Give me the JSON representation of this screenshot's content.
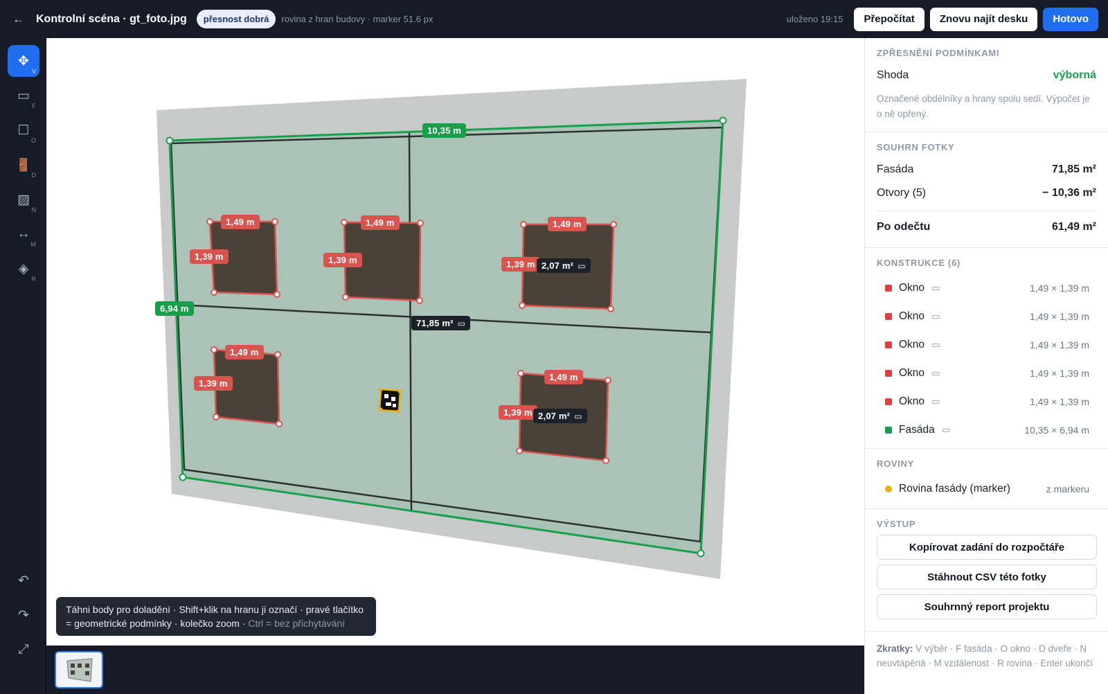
{
  "header": {
    "back_icon": "←",
    "title": "Kontrolní scéna · gt_foto.jpg",
    "badge": "přesnost dobrá",
    "subinfo": "rovina z hran budovy · marker 51.6 px",
    "saved": "uloženo 19:15",
    "btn_recalc": "Přepočítat",
    "btn_find": "Znovu najít desku",
    "btn_done": "Hotovo"
  },
  "tools": [
    {
      "icon": "✥",
      "key": "V",
      "name": "move-tool-icon"
    },
    {
      "icon": "▭",
      "key": "F",
      "name": "facade-tool-icon"
    },
    {
      "icon": "☐",
      "key": "O",
      "name": "window-tool-icon"
    },
    {
      "icon": "🚪",
      "key": "D",
      "name": "door-tool-icon"
    },
    {
      "icon": "▨",
      "key": "N",
      "name": "hatch-tool-icon"
    },
    {
      "icon": "↔",
      "key": "M",
      "name": "distance-tool-icon"
    },
    {
      "icon": "◈",
      "key": "R",
      "name": "plane-tool-icon"
    }
  ],
  "toolbar_bottom": {
    "undo": "↶",
    "redo": "↷",
    "fit": "⤢"
  },
  "canvas": {
    "labels": {
      "facade_width": "10,35 m",
      "facade_height": "6,94 m",
      "facade_area": "71,85 m²",
      "win_w": "1,49 m",
      "win_h": "1,39 m",
      "win_area": "2,07 m²",
      "edit_icon": "▭"
    },
    "hint": {
      "text": "Táhni body pro doladění · Shift+klik na hranu ji označí · pravé tlačítko = geometrické podmínky · kolečko zoom · ",
      "muted": "Ctrl = bez přichytávání"
    }
  },
  "panel": {
    "refine": {
      "heading": "ZPŘESNĚNÍ PODMÍNKAMI",
      "label": "Shoda",
      "value": "výborná",
      "note": "Označené obdélníky a hrany spolu sedí. Výpočet je o ně opřený."
    },
    "summary": {
      "heading": "SOUHRN FOTKY",
      "facade_label": "Fasáda",
      "facade_value": "71,85 m²",
      "openings_label": "Otvory (5)",
      "openings_value": "− 10,36 m²",
      "total_label": "Po odečtu",
      "total_value": "61,49 m²"
    },
    "constructions": {
      "heading": "KONSTRUKCE (6)",
      "icon": "▭",
      "items": [
        {
          "name": "Okno",
          "dims": "1,49 × 1,39 m",
          "color": "#e03f3f"
        },
        {
          "name": "Okno",
          "dims": "1,49 × 1,39 m",
          "color": "#e03f3f"
        },
        {
          "name": "Okno",
          "dims": "1,49 × 1,39 m",
          "color": "#e03f3f"
        },
        {
          "name": "Okno",
          "dims": "1,49 × 1,39 m",
          "color": "#e03f3f"
        },
        {
          "name": "Okno",
          "dims": "1,49 × 1,39 m",
          "color": "#e03f3f"
        },
        {
          "name": "Fasáda",
          "dims": "10,35 × 6,94 m",
          "color": "#17a04a"
        }
      ]
    },
    "planes": {
      "heading": "ROVINY",
      "item": "Rovina fasády (marker)",
      "source": "z markeru",
      "color": "#e9b10f"
    },
    "output": {
      "heading": "VÝSTUP",
      "btn1": "Kopírovat zadání do rozpočtáře",
      "btn2": "Stáhnout CSV této fotky",
      "btn3": "Souhrnný report projektu"
    },
    "shortcuts": {
      "label": "Zkratky:",
      "text": " V výběr · F fasáda · O okno · D dveře · N neuvtápěná · M vzdálenost · R rovina · Enter ukončí"
    }
  },
  "colors": {
    "accent": "#1f6ef0",
    "facade": "#17a04a",
    "window": "#d9534f",
    "marker": "#e9b10f"
  }
}
